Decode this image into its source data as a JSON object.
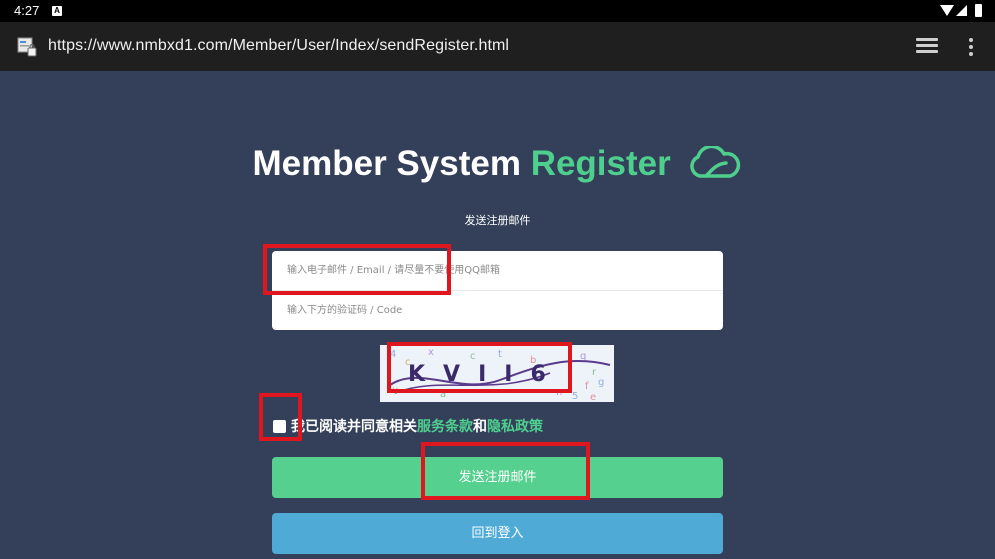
{
  "status_bar": {
    "time": "4:27",
    "notification_icon": "A"
  },
  "browser": {
    "url": "https://www.nmbxd1.com/Member/User/Index/sendRegister.html"
  },
  "page": {
    "title_main": "Member System",
    "title_accent": "Register",
    "subtitle": "发送注册邮件",
    "email_placeholder": "输入电子邮件 / Email / 请尽量不要使用QQ邮箱",
    "code_placeholder": "输入下方的验证码 / Code",
    "captcha_text": "KVII6",
    "agree_prefix": "我已阅读并同意相关",
    "terms_link": "服务条款",
    "agree_and": "和",
    "privacy_link": "隐私政策",
    "send_button": "发送注册邮件",
    "login_button": "回到登入"
  },
  "colors": {
    "background": "#34405a",
    "accent_green": "#4fcf8e",
    "send_button": "#55d08e",
    "login_button": "#4faad6",
    "highlight_red": "#e0161e"
  },
  "icons": [
    "wifi-icon",
    "signal-icon",
    "battery-icon",
    "site-info-icon",
    "tabs-icon",
    "more-vert-icon",
    "cloud-logo-icon"
  ]
}
